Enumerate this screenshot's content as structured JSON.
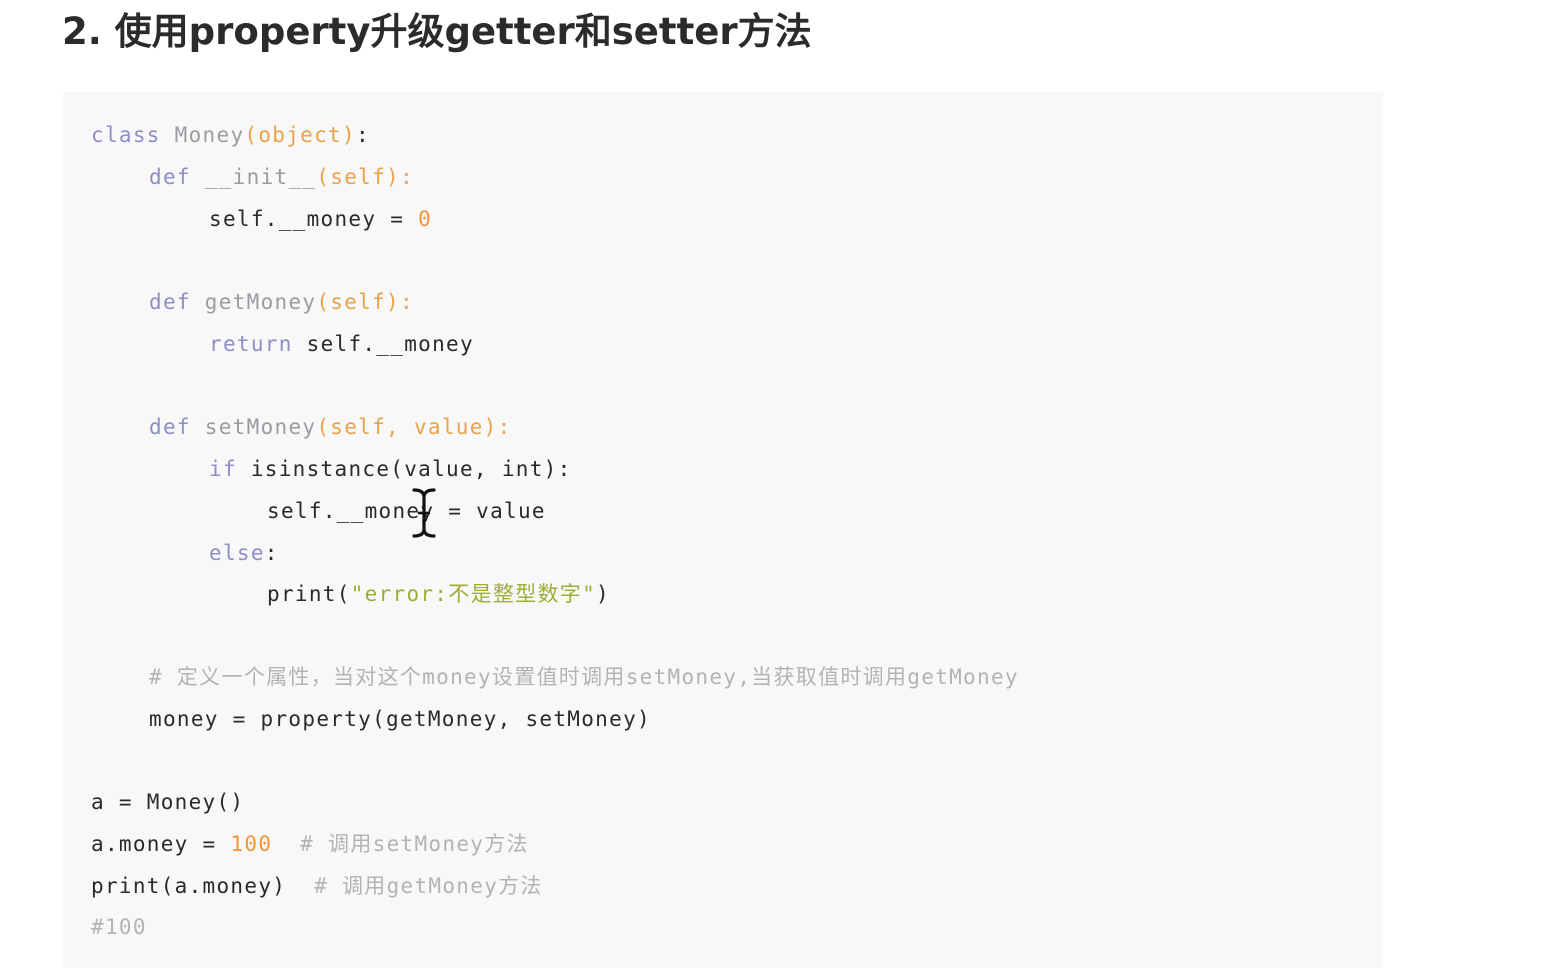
{
  "heading": "2. 使用property升级getter和setter方法",
  "code": {
    "l1": {
      "kw": "class",
      "name": "Money",
      "args": "(object)",
      "end": ":"
    },
    "l2": {
      "kw": "def",
      "name": "__init__",
      "args": "(self)",
      "end": ":"
    },
    "l3": {
      "text": "self.__money = ",
      "num": "0"
    },
    "l4": {
      "kw": "def",
      "name": "getMoney",
      "args": "(self)",
      "end": ":"
    },
    "l5": {
      "kw": "return",
      "text": "self.__money"
    },
    "l6": {
      "kw": "def",
      "name": "setMoney",
      "args": "(self, value)",
      "end": ":"
    },
    "l7": {
      "kw": "if",
      "text": "isinstance(value, int):"
    },
    "l8": {
      "text": "self.__money = value"
    },
    "l9": {
      "kw": "else",
      "end": ":"
    },
    "l10": {
      "pre": "print(",
      "str": "\"error:不是整型数字\"",
      "post": ")"
    },
    "l11": {
      "cmt": "# 定义一个属性，当对这个money设置值时调用setMoney,当获取值时调用getMoney"
    },
    "l12": {
      "text": "money = property(getMoney, setMoney)"
    },
    "l13": {
      "text": "a = Money()"
    },
    "l14": {
      "text": "a.money = ",
      "num": "100",
      "cmt": "# 调用setMoney方法"
    },
    "l15": {
      "text": "print(a.money)",
      "cmt": "# 调用getMoney方法"
    },
    "l16": {
      "cmt": "#100"
    }
  },
  "cursor_icon": "text-cursor-ibeam-icon",
  "colors": {
    "keyword": "#8b8fc7",
    "paren": "#e8a24a",
    "number": "#f0963c",
    "string": "#9fae33",
    "comment": "#b3b3b3",
    "code_bg": "#f8f8f8"
  }
}
